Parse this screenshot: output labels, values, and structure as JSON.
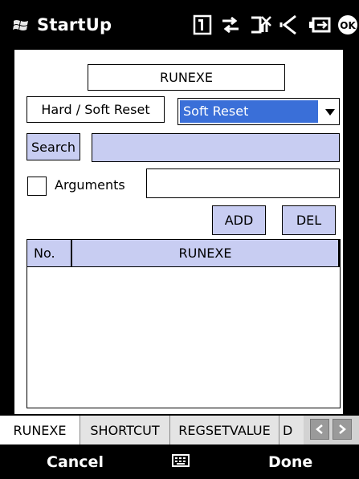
{
  "titlebar": {
    "title": "StartUp",
    "ok_label": "OK"
  },
  "form": {
    "section_title": "RUNEXE",
    "reset_label": "Hard / Soft Reset",
    "reset_value": "Soft Reset",
    "search_label": "Search",
    "search_value": "",
    "arguments_label": "Arguments",
    "arguments_checked": false,
    "arguments_value": "",
    "add_label": "ADD",
    "del_label": "DEL"
  },
  "list": {
    "columns": [
      "No.",
      "RUNEXE"
    ],
    "rows": []
  },
  "tabs": [
    {
      "label": "RUNEXE",
      "active": true
    },
    {
      "label": "SHORTCUT",
      "active": false
    },
    {
      "label": "REGSETVALUE",
      "active": false
    },
    {
      "label": "D",
      "active": false
    }
  ],
  "softkeys": {
    "left": "Cancel",
    "right": "Done"
  },
  "colors": {
    "accent_blue": "#3a6fd8",
    "field_lavender": "#c8cdf2"
  }
}
